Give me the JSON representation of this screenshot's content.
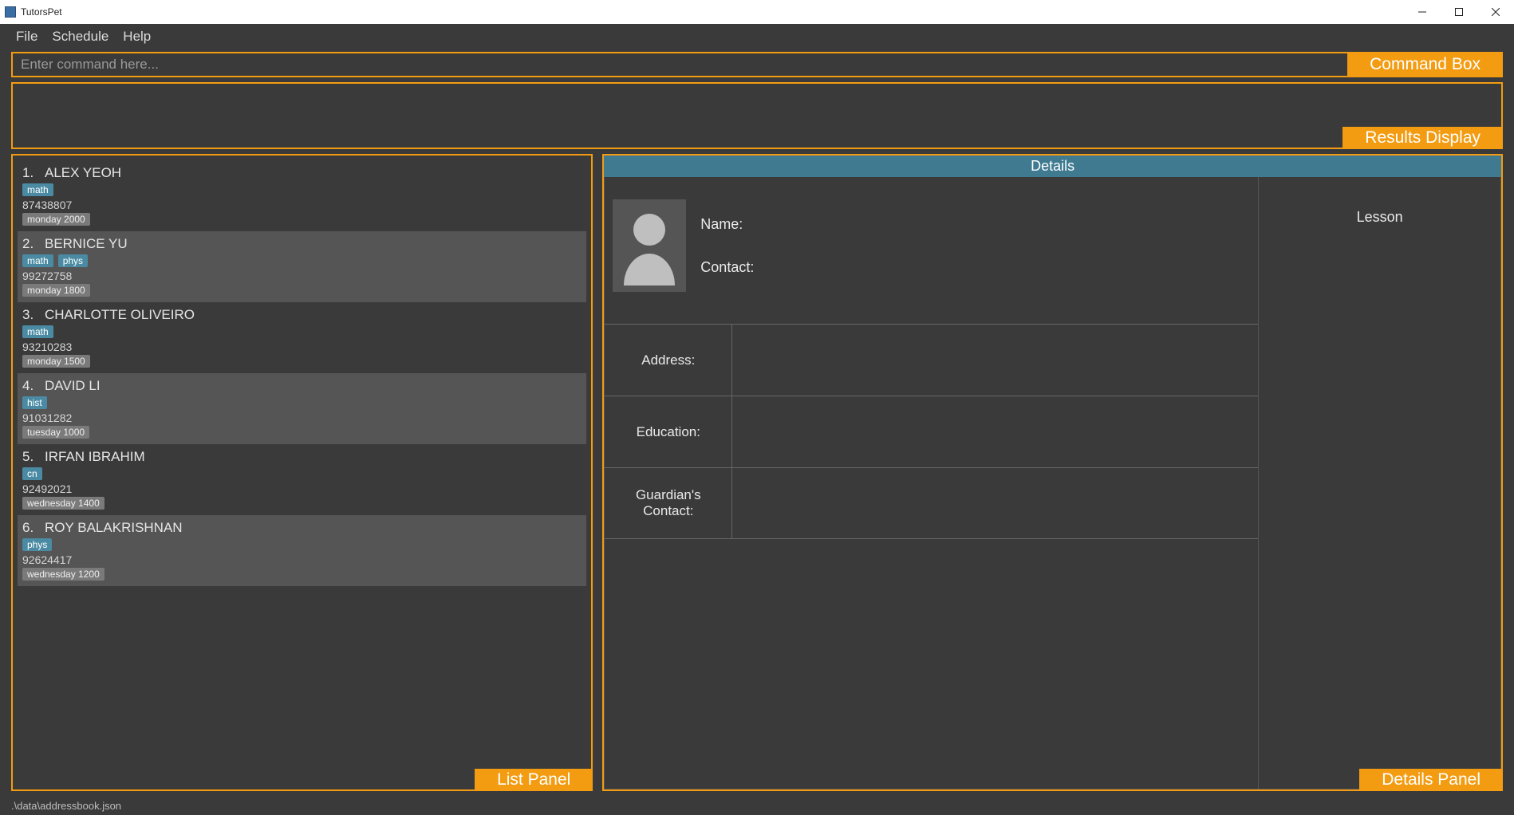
{
  "window": {
    "title": "TutorsPet"
  },
  "menu": {
    "file": "File",
    "schedule": "Schedule",
    "help": "Help"
  },
  "command": {
    "placeholder": "Enter command here...",
    "label": "Command Box"
  },
  "results": {
    "label": "Results Display"
  },
  "list": {
    "label": "List Panel",
    "items": [
      {
        "index": "1.",
        "name": "ALEX YEOH",
        "subjects": [
          "math"
        ],
        "phone": "87438807",
        "schedule": "monday 2000"
      },
      {
        "index": "2.",
        "name": "BERNICE YU",
        "subjects": [
          "math",
          "phys"
        ],
        "phone": "99272758",
        "schedule": "monday 1800"
      },
      {
        "index": "3.",
        "name": "CHARLOTTE OLIVEIRO",
        "subjects": [
          "math"
        ],
        "phone": "93210283",
        "schedule": "monday 1500"
      },
      {
        "index": "4.",
        "name": "DAVID LI",
        "subjects": [
          "hist"
        ],
        "phone": "91031282",
        "schedule": "tuesday 1000"
      },
      {
        "index": "5.",
        "name": "IRFAN IBRAHIM",
        "subjects": [
          "cn"
        ],
        "phone": "92492021",
        "schedule": "wednesday 1400"
      },
      {
        "index": "6.",
        "name": "ROY BALAKRISHNAN",
        "subjects": [
          "phys"
        ],
        "phone": "92624417",
        "schedule": "wednesday 1200"
      }
    ]
  },
  "details": {
    "panel_label": "Details Panel",
    "header": "Details",
    "name_label": "Name:",
    "contact_label": "Contact:",
    "address_label": "Address:",
    "education_label": "Education:",
    "guardian_label": "Guardian's Contact:",
    "lesson_label": "Lesson"
  },
  "status": {
    "path": ".\\data\\addressbook.json"
  }
}
